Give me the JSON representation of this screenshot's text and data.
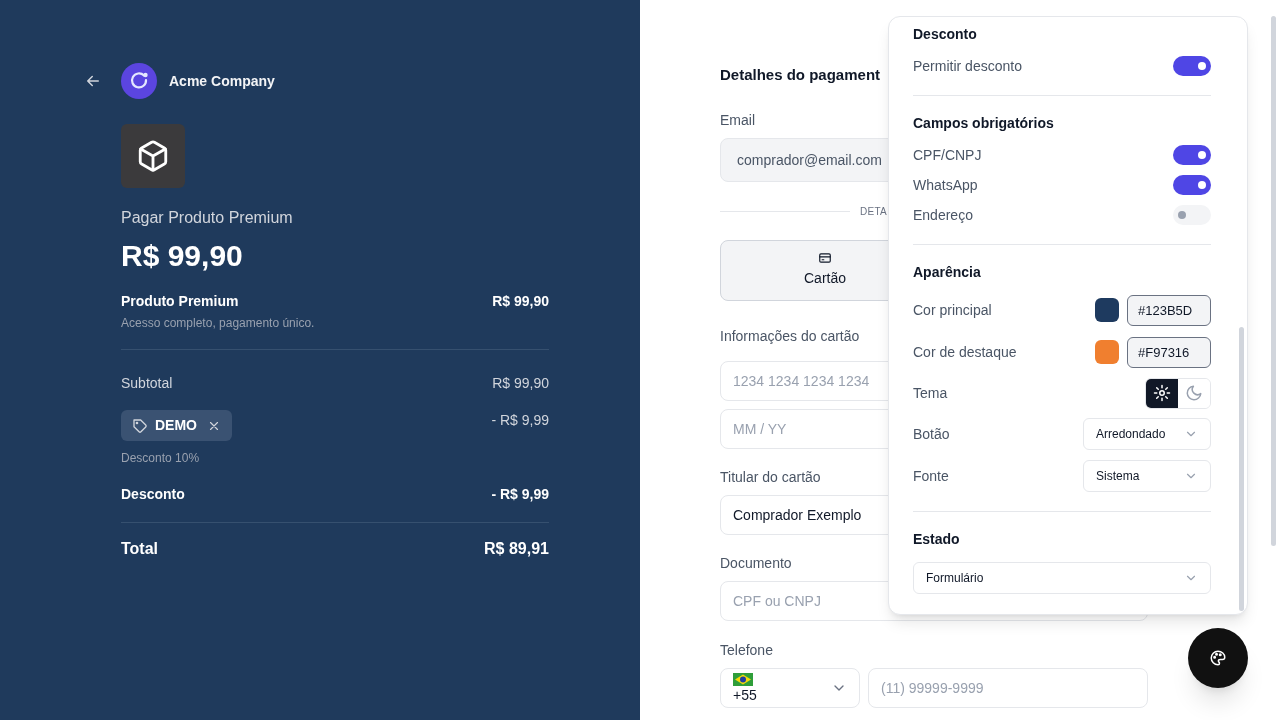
{
  "summary": {
    "company": "Acme Company",
    "product_title": "Pagar Produto Premium",
    "price": "R$ 99,90",
    "item": {
      "name": "Produto Premium",
      "description": "Acesso completo, pagamento único.",
      "amount": "R$ 99,90"
    },
    "subtotal": {
      "label": "Subtotal",
      "amount": "R$ 99,90"
    },
    "coupon": {
      "code": "DEMO",
      "amount": "- R$ 9,99",
      "note": "Desconto 10%"
    },
    "discount": {
      "label": "Desconto",
      "amount": "- R$ 9,99"
    },
    "total": {
      "label": "Total",
      "amount": "R$ 89,91"
    }
  },
  "form": {
    "title": "Detalhes do pagament",
    "email": {
      "label": "Email",
      "value": "comprador@email.com"
    },
    "divider_text": "DETA",
    "methods": [
      {
        "label": "Cartão",
        "selected": true
      }
    ],
    "card": {
      "label": "Informações do cartão",
      "number_placeholder": "1234 1234 1234 1234",
      "expiry_placeholder": "MM / YY"
    },
    "holder": {
      "label": "Titular do cartão",
      "value": "Comprador Exemplo"
    },
    "document": {
      "label": "Documento",
      "placeholder": "CPF ou CNPJ"
    },
    "phone": {
      "label": "Telefone",
      "country_code": "+55",
      "placeholder": "(11) 99999-9999"
    }
  },
  "settings_panel": {
    "sections": [
      {
        "title": "Desconto",
        "rows": [
          {
            "kind": "toggle",
            "label": "Permitir desconto",
            "on": true
          }
        ]
      },
      {
        "title": "Campos obrigatórios",
        "rows": [
          {
            "kind": "toggle",
            "label": "CPF/CNPJ",
            "on": true
          },
          {
            "kind": "toggle",
            "label": "WhatsApp",
            "on": true
          },
          {
            "kind": "toggle",
            "label": "Endereço",
            "on": false
          }
        ]
      },
      {
        "title": "Aparência",
        "rows": [
          {
            "kind": "color",
            "label": "Cor principal",
            "value": "#123B5D",
            "color": "#1e3a5f"
          },
          {
            "kind": "color",
            "label": "Cor de destaque",
            "value": "#F97316",
            "color": "#f07f2f"
          },
          {
            "kind": "theme",
            "label": "Tema",
            "options": [
              {
                "selected": true
              },
              {
                "selected": false
              }
            ]
          },
          {
            "kind": "select",
            "label": "Botão",
            "value": "Arredondado"
          },
          {
            "kind": "select",
            "label": "Fonte",
            "value": "Sistema"
          }
        ]
      },
      {
        "title": "Estado",
        "rows": [
          {
            "kind": "wide_select",
            "value": "Formulário"
          }
        ]
      }
    ]
  }
}
